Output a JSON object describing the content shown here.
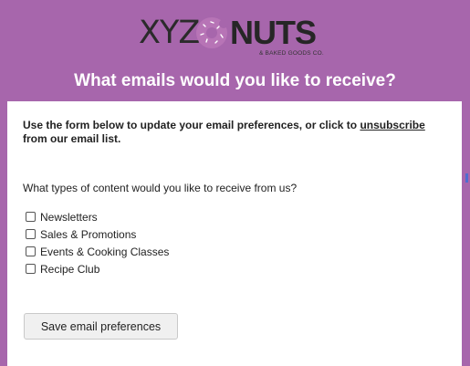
{
  "brand": {
    "prefix": "XYZ",
    "suffix": "NUTS",
    "tagline": "& BAKED GOODS CO.",
    "colors": {
      "background": "#a766ac",
      "donut": "#b774b6",
      "text": "#262626"
    }
  },
  "header": {
    "title": "What emails would you like to receive?"
  },
  "form": {
    "intro_text": "Use the form below to update your email preferences, or click to ",
    "unsubscribe_link": "unsubscribe",
    "intro_tail": " from our email list.",
    "question": "What types of content would you like to receive from us?",
    "options": [
      {
        "label": "Newsletters",
        "checked": false
      },
      {
        "label": "Sales & Promotions",
        "checked": false
      },
      {
        "label": "Events & Cooking Classes",
        "checked": false
      },
      {
        "label": "Recipe Club",
        "checked": false
      }
    ],
    "save_label": "Save email preferences"
  }
}
